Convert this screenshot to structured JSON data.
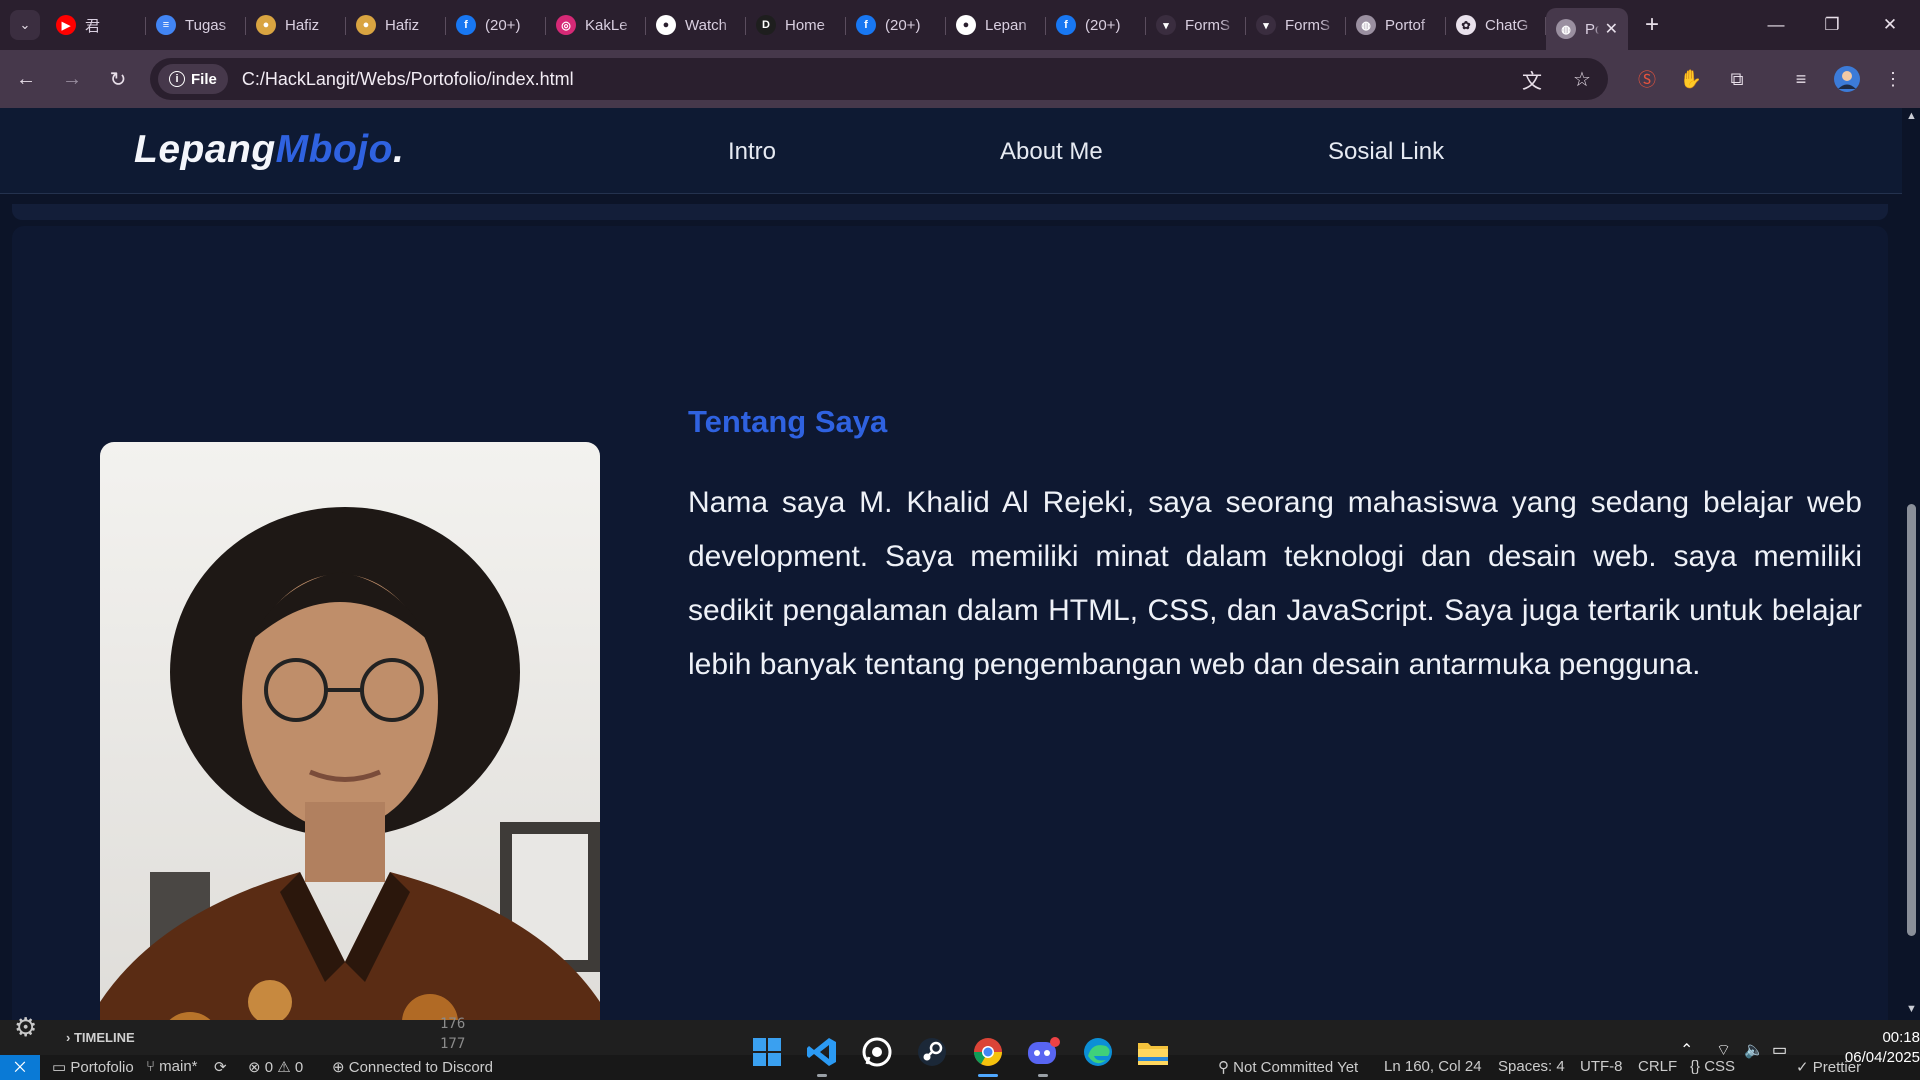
{
  "browser": {
    "tabs": [
      {
        "title": "君",
        "favicon": "youtube-icon",
        "color": "#ff0000",
        "glyph": "▶"
      },
      {
        "title": "Tugas",
        "favicon": "docs-icon",
        "color": "#4285f4",
        "glyph": "≡"
      },
      {
        "title": "Hafiz",
        "favicon": "hafiz-icon",
        "color": "#d9a441",
        "glyph": "●"
      },
      {
        "title": "Hafiz",
        "favicon": "hafiz-icon",
        "color": "#d9a441",
        "glyph": "●"
      },
      {
        "title": "(20+)",
        "favicon": "facebook-icon",
        "color": "#1877f2",
        "glyph": "f"
      },
      {
        "title": "KakLe",
        "favicon": "instagram-icon",
        "color": "#d62976",
        "glyph": "◎"
      },
      {
        "title": "Watch",
        "favicon": "github-icon",
        "color": "#ffffff",
        "glyph": "●"
      },
      {
        "title": "Home",
        "favicon": "d-icon",
        "color": "#1e1e1e",
        "glyph": "D"
      },
      {
        "title": "(20+)",
        "favicon": "facebook-icon",
        "color": "#1877f2",
        "glyph": "f"
      },
      {
        "title": "Lepan",
        "favicon": "github-icon",
        "color": "#ffffff",
        "glyph": "●"
      },
      {
        "title": "(20+)",
        "favicon": "facebook-icon",
        "color": "#1877f2",
        "glyph": "f"
      },
      {
        "title": "FormS",
        "favicon": "forms-icon",
        "color": "#3a2d3f",
        "glyph": "▾"
      },
      {
        "title": "FormS",
        "favicon": "forms-icon",
        "color": "#3a2d3f",
        "glyph": "▾"
      },
      {
        "title": "Portof",
        "favicon": "globe-icon",
        "color": "#9a8fa0",
        "glyph": "◍"
      },
      {
        "title": "ChatG",
        "favicon": "chatgpt-icon",
        "color": "#e9e1ec",
        "glyph": "✿"
      }
    ],
    "active_tab": {
      "title": "Pc",
      "favicon": "globe-icon"
    },
    "new_tab": "+",
    "file_chip": "File",
    "url": "C:/HackLangit/Webs/Portofolio/index.html"
  },
  "page": {
    "logo_main": "Lepang",
    "logo_accent": "Mbojo",
    "logo_dot": ".",
    "nav": [
      "Intro",
      "About Me",
      "Sosial Link"
    ],
    "about_title": "Tentang Saya",
    "about_text": "Nama saya M. Khalid Al Rejeki, saya seorang mahasiswa yang sedang belajar web development. Saya memiliki minat dalam teknologi dan desain web. saya memiliki sedikit pengalaman dalam HTML, CSS, dan JavaScript. Saya juga tertarik untuk belajar lebih banyak tentang pengembangan web dan desain antarmuka pengguna."
  },
  "editor": {
    "timeline": "TIMELINE",
    "line_numbers": [
      "176",
      "177"
    ]
  },
  "status": {
    "folder": "Portofolio",
    "branch": "main*",
    "errors": "0",
    "warnings": "0",
    "discord": "Connected to Discord",
    "commit": "Not Committed Yet",
    "position": "Ln 160, Col 24",
    "spaces": "Spaces: 4",
    "encoding": "UTF-8",
    "eol": "CRLF",
    "language": "CSS",
    "formatter": "Prettier"
  },
  "clock": {
    "time": "00:18",
    "date": "06/04/2025"
  },
  "colors": {
    "accent": "#2f62e0",
    "page_bg": "#0c1428",
    "tab_strip": "#2a1f2e",
    "toolbar": "#46384b"
  }
}
